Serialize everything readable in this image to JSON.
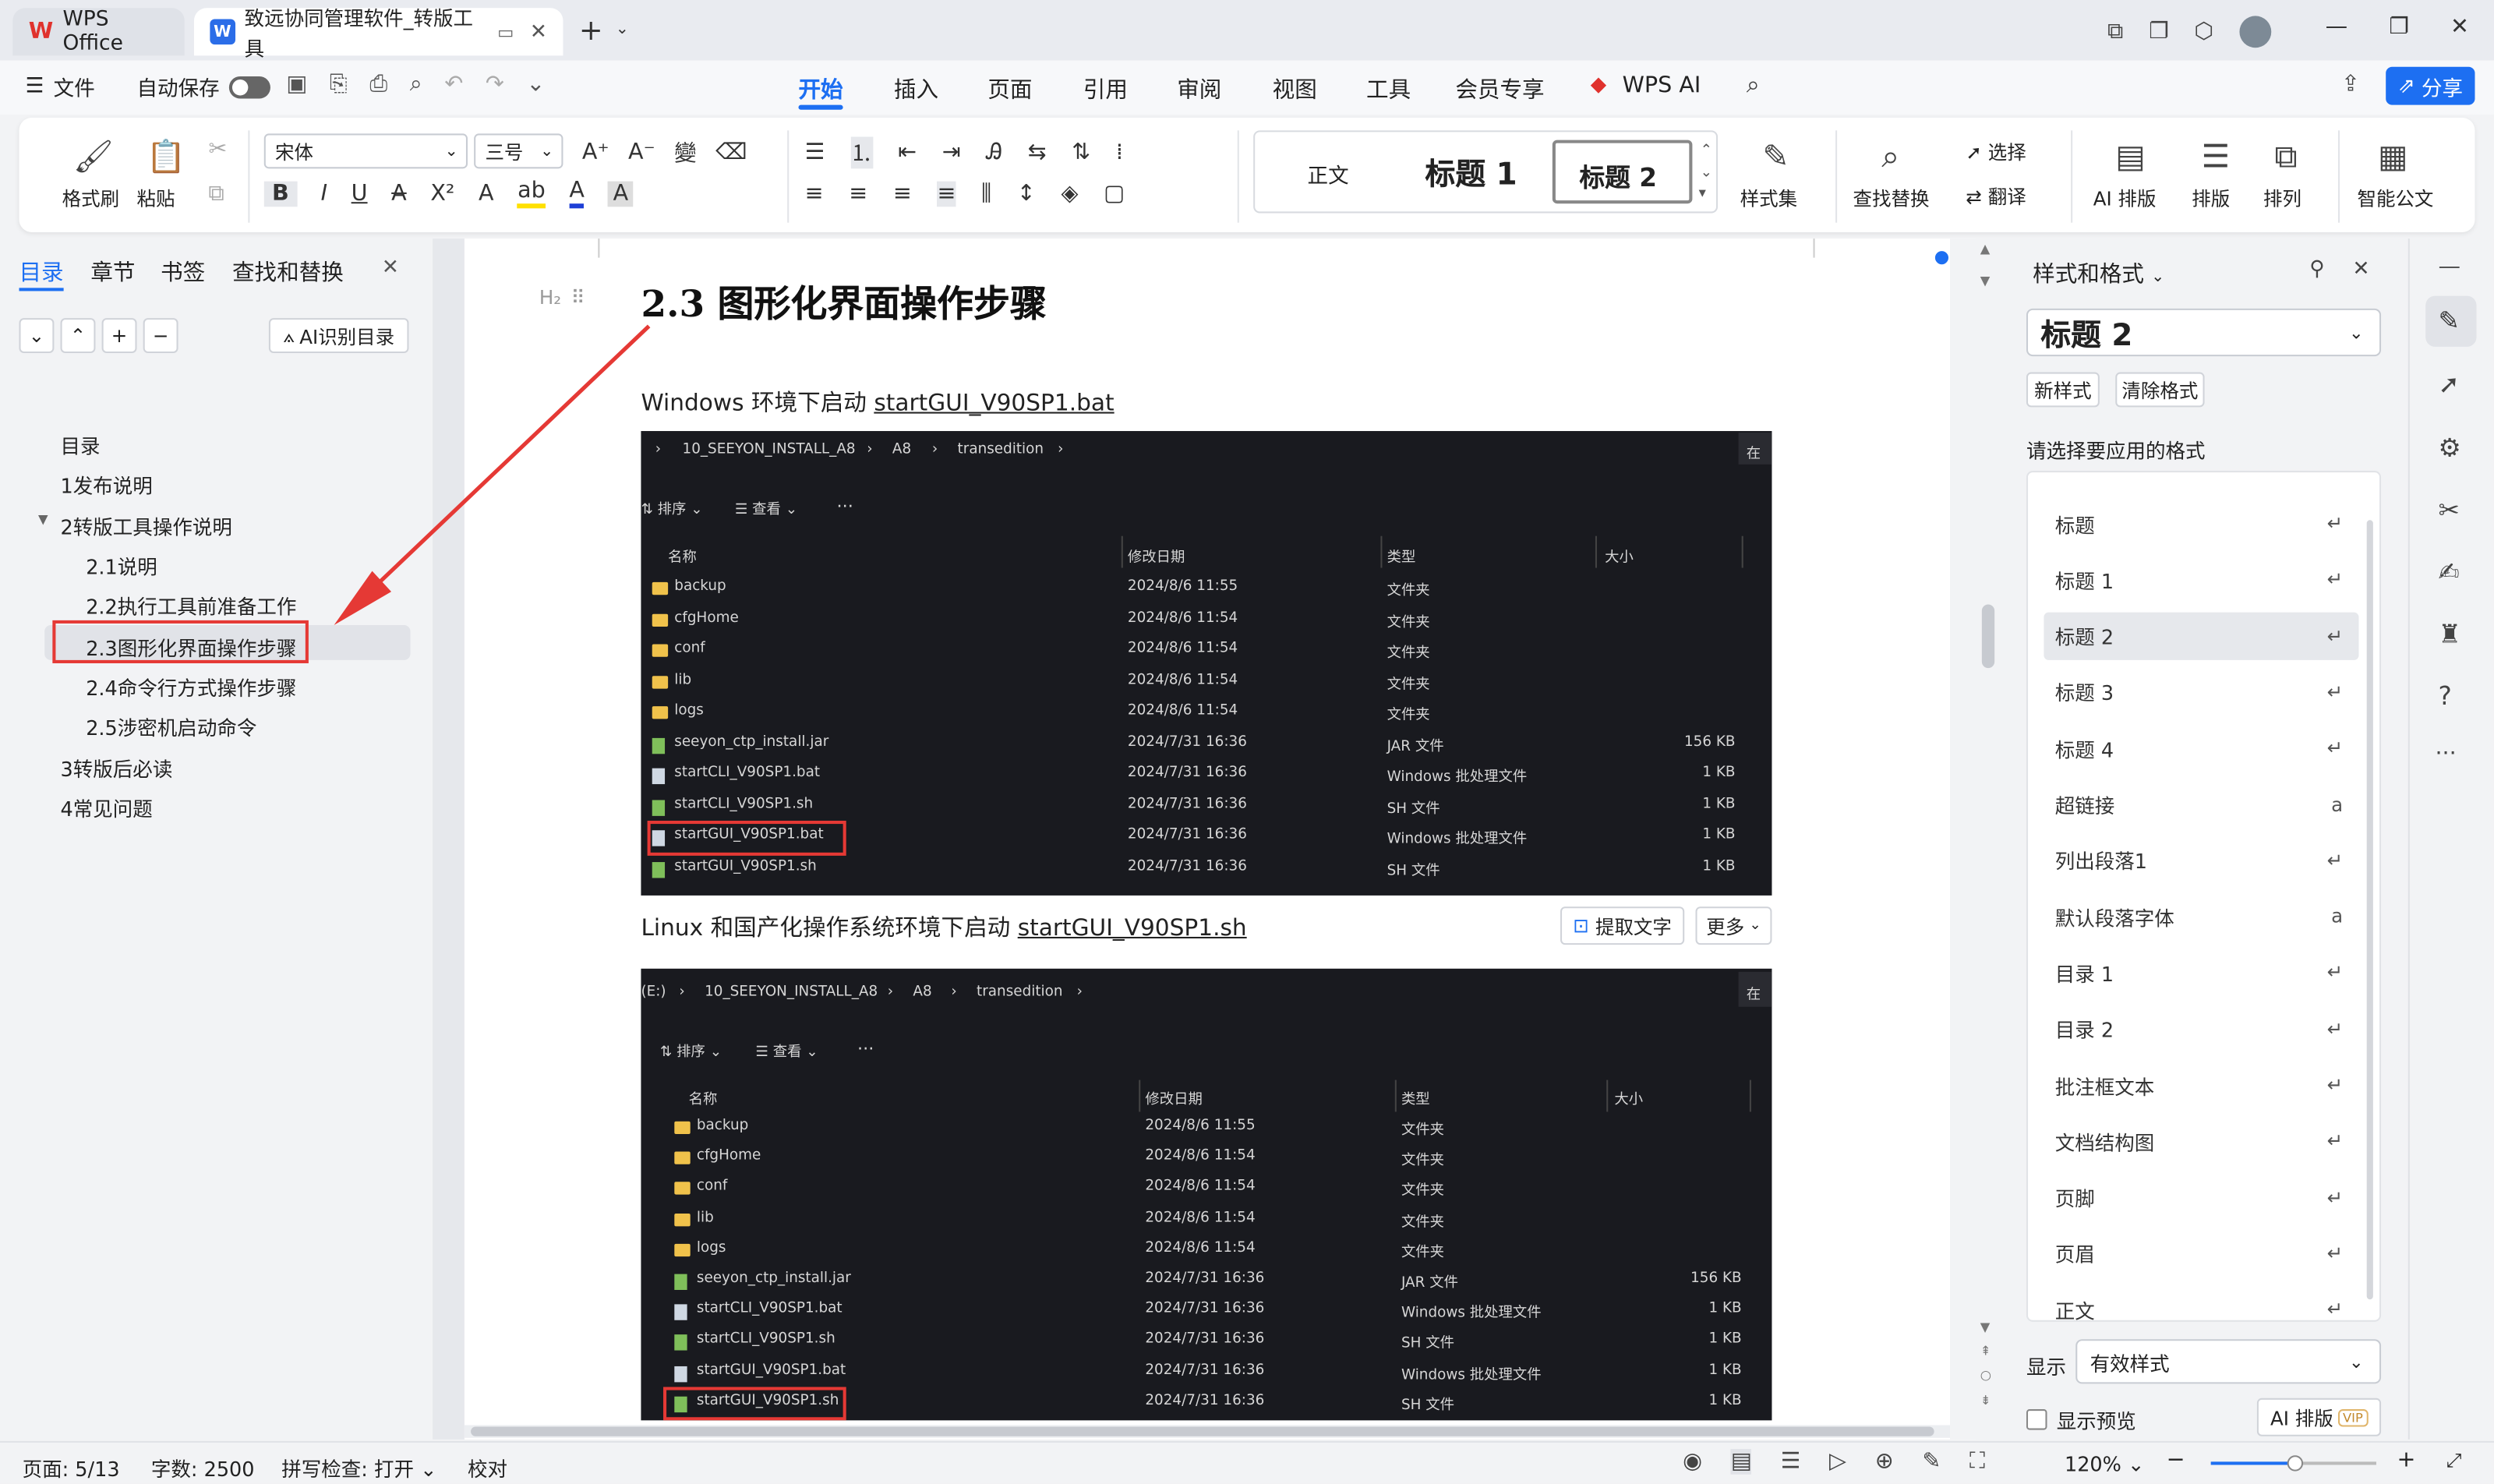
{
  "tabs": {
    "wps_label": "WPS Office",
    "doc_title": "致远协同管理软件_转版工具"
  },
  "menu": {
    "file": "文件",
    "autosave": "自动保存",
    "items": [
      "开始",
      "插入",
      "页面",
      "引用",
      "审阅",
      "视图",
      "工具",
      "会员专享",
      "WPS AI"
    ]
  },
  "share": "分享",
  "ribbon": {
    "format_brush": "格式刷",
    "paste": "粘贴",
    "font": "宋体",
    "size": "三号",
    "styles": {
      "normal": "正文",
      "h1": "标题 1",
      "h2": "标题 2"
    },
    "style_set": "样式集",
    "find_replace": "查找替换",
    "select": "选择",
    "translate": "翻译",
    "ai_layout": "AI 排版",
    "layout": "排版",
    "arrange": "排列",
    "smart_doc": "智能公文"
  },
  "nav": {
    "tabs": [
      "目录",
      "章节",
      "书签",
      "查找和替换"
    ],
    "ai_toc": "AI识别目录",
    "items": [
      "目录",
      "1发布说明",
      "2转版工具操作说明",
      "2.1说明",
      "2.2执行工具前准备工作",
      "2.3图形化界面操作步骤",
      "2.4命令行方式操作步骤",
      "2.5涉密机启动命令",
      "3转版后必读",
      "4常见问题"
    ]
  },
  "doc": {
    "heading_tag": "H₂",
    "heading": "2.3  图形化界面操作步骤",
    "para1_prefix": "Windows 环境下启动 ",
    "para1_file": "startGUI_V90SP1.bat",
    "para2_prefix": "Linux 和国产化操作系统环境下启动 ",
    "para2_file": "startGUI_V90SP1.sh",
    "extract_text": "提取文字",
    "more": "更多",
    "explorer": {
      "path1": [
        "10_SEEYON_INSTALL_A8",
        "A8",
        "transedition"
      ],
      "path2": [
        "(E:)",
        "10_SEEYON_INSTALL_A8",
        "A8",
        "transedition"
      ],
      "search_stub": "在",
      "sort": "排序",
      "view": "查看",
      "more": "···",
      "cols": [
        "名称",
        "修改日期",
        "类型",
        "大小"
      ],
      "rows": [
        {
          "name": "backup",
          "date": "2024/8/6 11:55",
          "type": "文件夹",
          "size": ""
        },
        {
          "name": "cfgHome",
          "date": "2024/8/6 11:54",
          "type": "文件夹",
          "size": ""
        },
        {
          "name": "conf",
          "date": "2024/8/6 11:54",
          "type": "文件夹",
          "size": ""
        },
        {
          "name": "lib",
          "date": "2024/8/6 11:54",
          "type": "文件夹",
          "size": ""
        },
        {
          "name": "logs",
          "date": "2024/8/6 11:54",
          "type": "文件夹",
          "size": ""
        },
        {
          "name": "seeyon_ctp_install.jar",
          "date": "2024/7/31 16:36",
          "type": "JAR 文件",
          "size": "156 KB"
        },
        {
          "name": "startCLI_V90SP1.bat",
          "date": "2024/7/31 16:36",
          "type": "Windows 批处理文件",
          "size": "1 KB"
        },
        {
          "name": "startCLI_V90SP1.sh",
          "date": "2024/7/31 16:36",
          "type": "SH 文件",
          "size": "1 KB"
        },
        {
          "name": "startGUI_V90SP1.bat",
          "date": "2024/7/31 16:36",
          "type": "Windows 批处理文件",
          "size": "1 KB"
        },
        {
          "name": "startGUI_V90SP1.sh",
          "date": "2024/7/31 16:36",
          "type": "SH 文件",
          "size": "1 KB"
        }
      ]
    }
  },
  "styles_panel": {
    "title": "样式和格式",
    "current": "标题 2",
    "new_style": "新样式",
    "clear_format": "清除格式",
    "prompt": "请选择要应用的格式",
    "items": [
      {
        "name": "标题",
        "mark": "↵"
      },
      {
        "name": "标题 1",
        "mark": "↵"
      },
      {
        "name": "标题 2",
        "mark": "↵"
      },
      {
        "name": "标题 3",
        "mark": "↵"
      },
      {
        "name": "标题 4",
        "mark": "↵"
      },
      {
        "name": "超链接",
        "mark": "a"
      },
      {
        "name": "列出段落1",
        "mark": "↵"
      },
      {
        "name": "默认段落字体",
        "mark": "a"
      },
      {
        "name": "目录 1",
        "mark": "↵"
      },
      {
        "name": "目录 2",
        "mark": "↵"
      },
      {
        "name": "批注框文本",
        "mark": "↵"
      },
      {
        "name": "文档结构图",
        "mark": "↵"
      },
      {
        "name": "页脚",
        "mark": "↵"
      },
      {
        "name": "页眉",
        "mark": "↵"
      },
      {
        "name": "正文",
        "mark": "↵"
      }
    ],
    "show_label": "显示",
    "show_value": "有效样式",
    "preview": "显示预览",
    "ai_layout": "AI 排版",
    "vip": "VIP"
  },
  "status": {
    "page": "页面: 5/13",
    "words": "字数: 2500",
    "spell": "拼写检查: 打开",
    "proof": "校对",
    "zoom": "120%"
  },
  "colors": {
    "accent": "#1d6ff2",
    "annotation_red": "#e53935"
  }
}
